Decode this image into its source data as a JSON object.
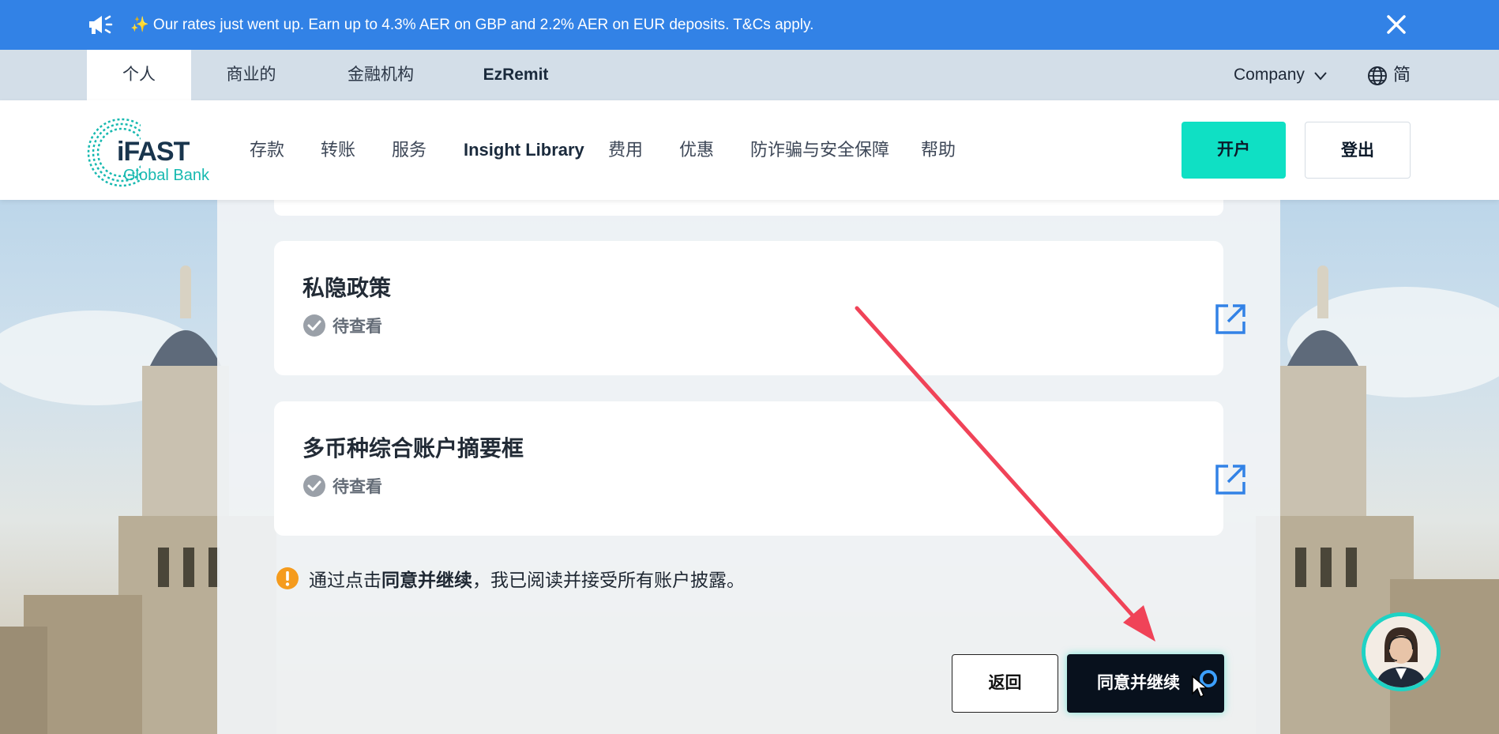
{
  "announcement": {
    "text": "✨ Our rates just went up. Earn up to 4.3% AER on GBP and 2.2% AER on EUR deposits. T&Cs apply.",
    "icon": "megaphone-icon",
    "close_icon": "close-icon"
  },
  "segments": {
    "items": [
      {
        "label": "个人",
        "active": true
      },
      {
        "label": "商业的",
        "active": false
      },
      {
        "label": "金融机构",
        "active": false
      },
      {
        "label": "EzRemit",
        "active": false
      }
    ],
    "company_label": "Company",
    "language_label": "简"
  },
  "brand": {
    "name": "iFAST",
    "subtitle": "Global Bank",
    "primary_color": "#0fe0c4",
    "accent_color": "#3282e6"
  },
  "nav": {
    "items": [
      "存款",
      "转账",
      "服务",
      "Insight Library",
      "费用",
      "优惠",
      "防诈骗与安全保障",
      "帮助"
    ],
    "open_account_label": "开户",
    "logout_label": "登出"
  },
  "documents": [
    {
      "title": "私隐政策",
      "status": "待查看"
    },
    {
      "title": "多币种综合账户摘要框",
      "status": "待查看"
    }
  ],
  "notice": {
    "prefix": "通过点击",
    "bold": "同意并继续",
    "suffix": "，我已阅读并接受所有账户披露。"
  },
  "actions": {
    "back_label": "返回",
    "agree_label": "同意并继续"
  }
}
